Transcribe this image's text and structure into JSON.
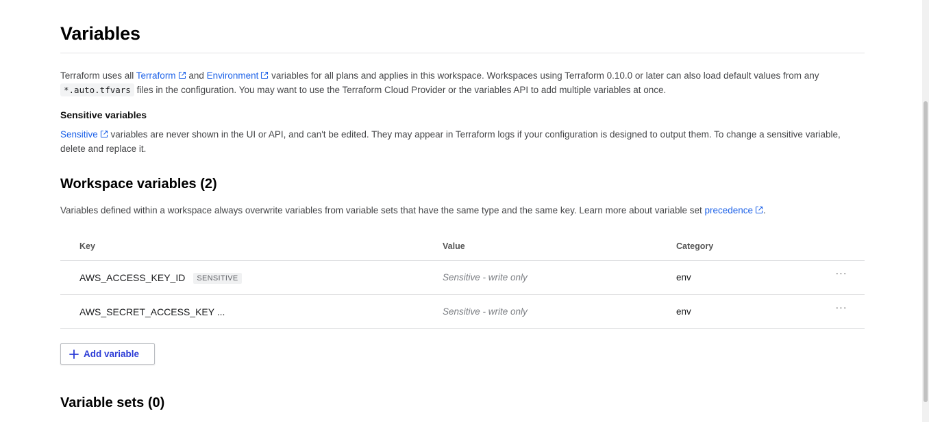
{
  "page": {
    "title": "Variables",
    "intro": {
      "prefix": "Terraform uses all ",
      "link1": "Terraform",
      "mid": " and ",
      "link2": "Environment",
      "after_links": " variables for all plans and applies in this workspace. Workspaces using Terraform 0.10.0 or later can also load default values from any ",
      "code": "*.auto.tfvars",
      "suffix": " files in the configuration. You may want to use the Terraform Cloud Provider or the variables API to add multiple variables at once."
    },
    "sensitive_section": {
      "heading": "Sensitive variables",
      "link": "Sensitive",
      "text": " variables are never shown in the UI or API, and can't be edited. They may appear in Terraform logs if your configuration is designed to output them. To change a sensitive variable, delete and replace it."
    },
    "workspace_section": {
      "heading": "Workspace variables (2)",
      "desc_prefix": "Variables defined within a workspace always overwrite variables from variable sets that have the same type and the same key. Learn more about variable set ",
      "desc_link": "precedence",
      "desc_suffix": "."
    },
    "table": {
      "columns": [
        "Key",
        "Value",
        "Category"
      ],
      "rows": [
        {
          "key": "AWS_ACCESS_KEY_ID",
          "badge": "SENSITIVE",
          "value": "Sensitive - write only",
          "category": "env",
          "menu": "···"
        },
        {
          "key": "AWS_SECRET_ACCESS_KEY ...",
          "badge": "",
          "value": "Sensitive - write only",
          "category": "env",
          "menu": "···"
        }
      ]
    },
    "add_button": "Add variable",
    "variable_sets_heading": "Variable sets (0)"
  },
  "colors": {
    "link": "#1d62e8",
    "button_text": "#2b3bd6"
  }
}
